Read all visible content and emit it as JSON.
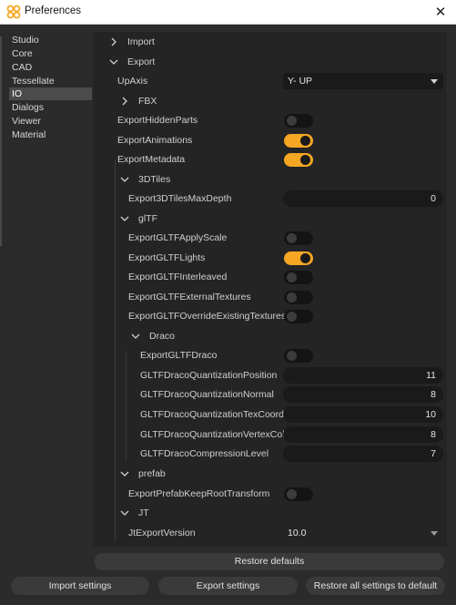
{
  "window": {
    "title": "Preferences",
    "close_glyph": "✕",
    "icon": "app-logo-icon",
    "accent": "#f5a623"
  },
  "sidebar": {
    "items": [
      {
        "label": "Studio",
        "selected": false
      },
      {
        "label": "Core",
        "selected": false
      },
      {
        "label": "CAD",
        "selected": false
      },
      {
        "label": "Tessellate",
        "selected": false
      },
      {
        "label": "IO",
        "selected": true
      },
      {
        "label": "Dialogs",
        "selected": false
      },
      {
        "label": "Viewer",
        "selected": false
      },
      {
        "label": "Material",
        "selected": false
      }
    ]
  },
  "tree": {
    "import_label": "Import",
    "export_label": "Export",
    "upaxis": {
      "label": "UpAxis",
      "value": "Y- UP"
    },
    "fbx_label": "FBX",
    "export_hidden_parts": {
      "label": "ExportHiddenParts",
      "on": false
    },
    "export_animations": {
      "label": "ExportAnimations",
      "on": true
    },
    "export_metadata": {
      "label": "ExportMetadata",
      "on": true
    },
    "tiles_label": "3DTiles",
    "tiles_max_depth": {
      "label": "Export3DTilesMaxDepth",
      "value": "0"
    },
    "gltf_label": "glTF",
    "gltf_apply_scale": {
      "label": "ExportGLTFApplyScale",
      "on": false
    },
    "gltf_lights": {
      "label": "ExportGLTFLights",
      "on": true
    },
    "gltf_interleaved": {
      "label": "ExportGLTFInterleaved",
      "on": false
    },
    "gltf_external_textures": {
      "label": "ExportGLTFExternalTextures",
      "on": false
    },
    "gltf_override_textures": {
      "label": "ExportGLTFOverrideExistingTextures",
      "on": false
    },
    "draco_label": "Draco",
    "gltf_draco": {
      "label": "ExportGLTFDraco",
      "on": false
    },
    "draco_q_position": {
      "label": "GLTFDracoQuantizationPosition",
      "value": "11"
    },
    "draco_q_normal": {
      "label": "GLTFDracoQuantizationNormal",
      "value": "8"
    },
    "draco_q_texcoord": {
      "label": "GLTFDracoQuantizationTexCoord",
      "value": "10"
    },
    "draco_q_vertexcolor": {
      "label": "GLTFDracoQuantizationVertexColor",
      "value": "8"
    },
    "draco_compression": {
      "label": "GLTFDracoCompressionLevel",
      "value": "7"
    },
    "prefab_label": "prefab",
    "prefab_keep_root": {
      "label": "ExportPrefabKeepRootTransform",
      "on": false
    },
    "jt_label": "JT",
    "jt_version": {
      "label": "JtExportVersion",
      "value": "10.0"
    }
  },
  "buttons": {
    "restore_defaults": "Restore defaults",
    "import_settings": "Import settings",
    "export_settings": "Export settings",
    "restore_all": "Restore all settings to default"
  }
}
